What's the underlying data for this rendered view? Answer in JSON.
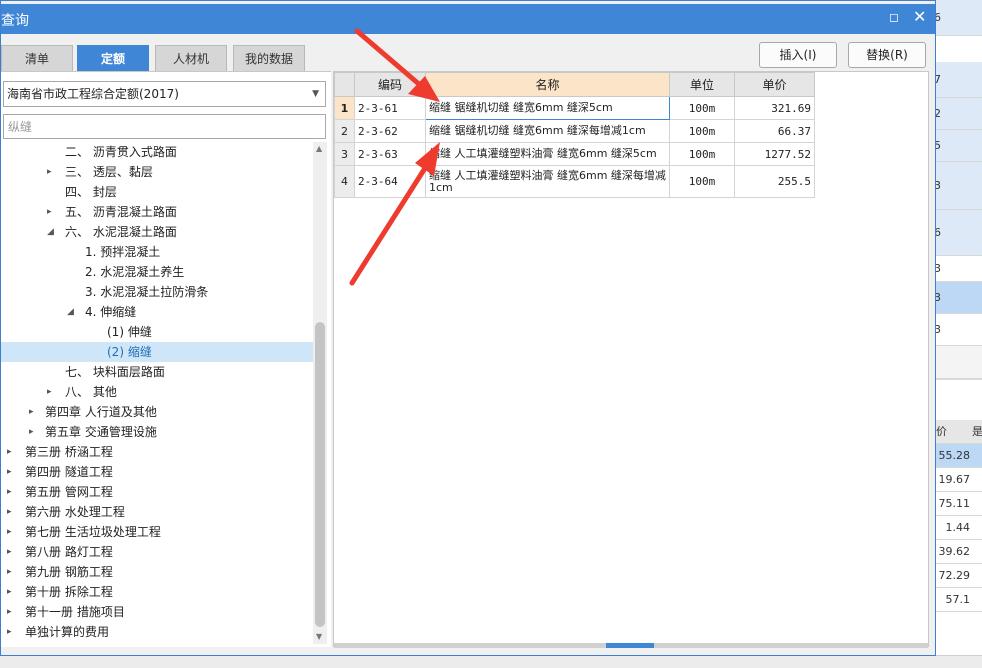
{
  "window": {
    "title": "查询",
    "maximize_icon": "maximize-icon",
    "close_icon": "close-icon"
  },
  "tabs": [
    {
      "label": "清单",
      "active": false
    },
    {
      "label": "定额",
      "active": true
    },
    {
      "label": "人材机",
      "active": false
    },
    {
      "label": "我的数据",
      "active": false
    }
  ],
  "actions": {
    "insert_label": "插入(I)",
    "replace_label": "替换(R)"
  },
  "quota_select": {
    "value": "海南省市政工程综合定额(2017)"
  },
  "search": {
    "value": "",
    "placeholder": "纵缝"
  },
  "tree": [
    {
      "label": "二、 沥青贯入式路面",
      "toggle": "",
      "selected": false
    },
    {
      "label": "三、 透层、黏层",
      "toggle": "▸",
      "selected": false
    },
    {
      "label": "四、 封层",
      "toggle": "",
      "selected": false
    },
    {
      "label": "五、 沥青混凝土路面",
      "toggle": "▸",
      "selected": false
    },
    {
      "label": "六、 水泥混凝土路面",
      "toggle": "◢",
      "selected": false
    },
    {
      "label": "1. 预拌混凝土",
      "toggle": "",
      "selected": false
    },
    {
      "label": "2. 水泥混凝土养生",
      "toggle": "",
      "selected": false
    },
    {
      "label": "3. 水泥混凝土拉防滑条",
      "toggle": "",
      "selected": false
    },
    {
      "label": "4. 伸缩缝",
      "toggle": "◢",
      "selected": false
    },
    {
      "label": "(1) 伸缝",
      "toggle": "",
      "selected": false
    },
    {
      "label": "(2) 缩缝",
      "toggle": "",
      "selected": true
    },
    {
      "label": "七、 块料面层路面",
      "toggle": "",
      "selected": false
    },
    {
      "label": "八、 其他",
      "toggle": "▸",
      "selected": false
    },
    {
      "label": "第四章 人行道及其他",
      "toggle": "▸",
      "selected": false
    },
    {
      "label": "第五章 交通管理设施",
      "toggle": "▸",
      "selected": false
    },
    {
      "label": "第三册 桥涵工程",
      "toggle": "▸",
      "selected": false
    },
    {
      "label": "第四册 隧道工程",
      "toggle": "▸",
      "selected": false
    },
    {
      "label": "第五册 管网工程",
      "toggle": "▸",
      "selected": false
    },
    {
      "label": "第六册 水处理工程",
      "toggle": "▸",
      "selected": false
    },
    {
      "label": "第七册 生活垃圾处理工程",
      "toggle": "▸",
      "selected": false
    },
    {
      "label": "第八册 路灯工程",
      "toggle": "▸",
      "selected": false
    },
    {
      "label": "第九册 钢筋工程",
      "toggle": "▸",
      "selected": false
    },
    {
      "label": "第十册 拆除工程",
      "toggle": "▸",
      "selected": false
    },
    {
      "label": "第十一册 措施项目",
      "toggle": "▸",
      "selected": false
    },
    {
      "label": "单独计算的费用",
      "toggle": "▸",
      "selected": false
    }
  ],
  "table": {
    "headers": {
      "code": "编码",
      "name": "名称",
      "unit": "单位",
      "price": "单价"
    },
    "rows": [
      {
        "num": "1",
        "code": "2-3-61",
        "name": "缩缝 锯缝机切缝 缝宽6mm 缝深5cm",
        "unit": "100m",
        "price": "321.69"
      },
      {
        "num": "2",
        "code": "2-3-62",
        "name": "缩缝 锯缝机切缝 缝宽6mm 缝深每增减1cm",
        "unit": "100m",
        "price": "66.37"
      },
      {
        "num": "3",
        "code": "2-3-63",
        "name": "缩缝 人工填灌缝塑料油膏 缝宽6mm 缝深5cm",
        "unit": "100m",
        "price": "1277.52"
      },
      {
        "num": "4",
        "code": "2-3-64",
        "name": "缩缝 人工填灌缝塑料油膏 缝宽6mm 缝深每增减1cm",
        "unit": "100m",
        "price": "255.5"
      }
    ]
  },
  "background": {
    "top_values": [
      "6",
      "7",
      "2",
      "5",
      "3",
      "6",
      "3",
      "3",
      "3"
    ],
    "bottom_header": [
      "价",
      "是"
    ],
    "bottom_values": [
      "55.28",
      "19.67",
      "75.11",
      "1.44",
      "39.62",
      "72.29",
      "57.1"
    ]
  },
  "colors": {
    "title_bar": "#3f86d6",
    "active_tab": "#3f86d6",
    "selected_tree": "#cfe6f8",
    "annotation_arrow": "#ee3b2e"
  }
}
